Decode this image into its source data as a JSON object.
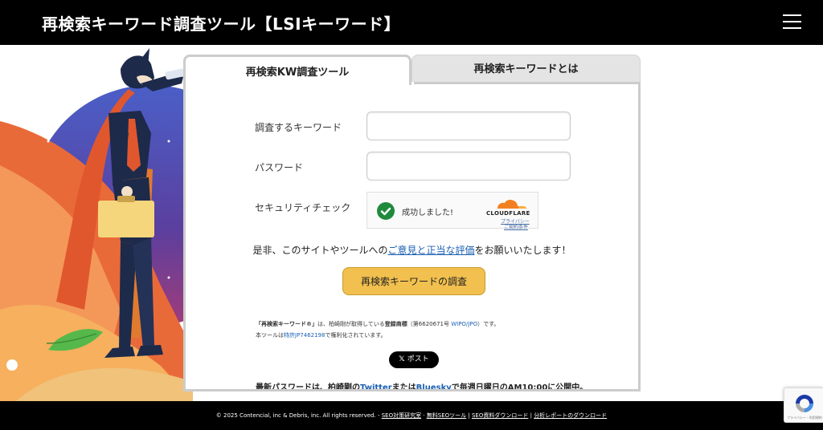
{
  "header": {
    "title": "再検索キーワード調査ツール【LSIキーワード】"
  },
  "tabs": [
    {
      "label": "再検索KW調査ツール",
      "active": true
    },
    {
      "label": "再検索キーワードとは",
      "active": false
    }
  ],
  "form": {
    "keyword_label": "調査するキーワード",
    "keyword_value": "",
    "password_label": "パスワード",
    "password_value": "",
    "security_label": "セキュリティチェック",
    "submit_label": "再検索キーワードの調査"
  },
  "turnstile": {
    "status": "成功しました!",
    "brand": "CLOUDFLARE",
    "privacy_link": "プライバシー",
    "terms_link": "ご契約条件"
  },
  "request": {
    "prefix": "是非、このサイトやツールへの",
    "link": "ご意見と正当な評価",
    "suffix": "をお願いいたします！"
  },
  "trademark": {
    "term": "「再検索キーワード®」",
    "text1": "は、柏崎剛が取得している",
    "registered": "登録商標",
    "text2": "（第6620671号 ",
    "wipo": "WIPO/JPO",
    "text3": "）です。",
    "line2_prefix": "本ツールは",
    "patent": "特許JP7462198",
    "line2_suffix": "で権利化されています。"
  },
  "share": {
    "post_label": "ポスト"
  },
  "password_note": {
    "prefix": "最新パスワードは、柏崎剛の",
    "twitter": "Twitter",
    "middle": "または",
    "bluesky": "Bluesky",
    "suffix": "で毎週日曜日のAM10:00に公開中。"
  },
  "footer": {
    "copyright": "© 2025 Contencial, inc & Debris, inc. All rights reserved.",
    "dash": " - ",
    "links": [
      "SEO対策研究室",
      "無料SEOツール",
      "SEO資料ダウンロード",
      "分析レポートのダウンロード"
    ]
  },
  "recaptcha": {
    "links": "プライバシー - 利用規約"
  },
  "colors": {
    "header_bg": "#000000",
    "accent_button": "#f2c04e",
    "link": "#1a5fb4",
    "success": "#1f8a3c",
    "cloudflare_orange": "#f38020"
  }
}
